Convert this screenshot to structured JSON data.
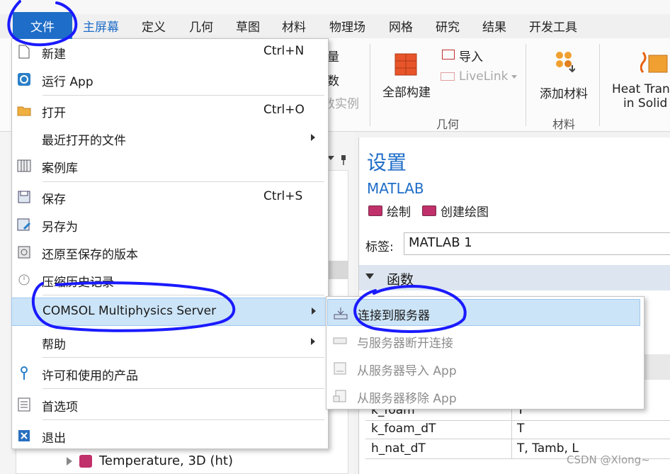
{
  "ribbon": {
    "tabs": [
      "文件",
      "主屏幕",
      "定义",
      "几何",
      "草图",
      "材料",
      "物理场",
      "网格",
      "研究",
      "结果",
      "开发工具"
    ],
    "partial_1": "量",
    "partial_2": "数",
    "partial_3": "数实例",
    "build_all": "全部构建",
    "import": "导入",
    "livelink": "LiveLink",
    "geometry_group": "几何",
    "add_material": "添加材料",
    "materials_group": "材料",
    "heat_line1": "Heat Tran",
    "heat_line2": "in Solid"
  },
  "file_menu": {
    "items": [
      {
        "icon": "new-file-icon",
        "label": "新建",
        "shortcut": "Ctrl+N"
      },
      {
        "icon": "run-app-icon",
        "label": "运行 App",
        "shortcut": ""
      },
      {
        "icon": "folder-icon",
        "label": "打开",
        "shortcut": "Ctrl+O"
      },
      {
        "icon": "",
        "label": "最近打开的文件",
        "shortcut": ""
      },
      {
        "icon": "library-icon",
        "label": "案例库",
        "shortcut": ""
      },
      {
        "icon": "save-icon",
        "label": "保存",
        "shortcut": "Ctrl+S"
      },
      {
        "icon": "save-as-icon",
        "label": "另存为",
        "shortcut": ""
      },
      {
        "icon": "revert-icon",
        "label": "还原至保存的版本",
        "shortcut": ""
      },
      {
        "icon": "compact-history-icon",
        "label": "压缩历史记录",
        "shortcut": ""
      },
      {
        "icon": "",
        "label": "COMSOL Multiphysics Server",
        "shortcut": ""
      },
      {
        "icon": "",
        "label": "帮助",
        "shortcut": ""
      },
      {
        "icon": "license-icon",
        "label": "许可和使用的产品",
        "shortcut": ""
      },
      {
        "icon": "preferences-icon",
        "label": "首选项",
        "shortcut": ""
      },
      {
        "icon": "exit-icon",
        "label": "退出",
        "shortcut": ""
      }
    ]
  },
  "server_submenu": {
    "items": [
      {
        "label": "连接到服务器",
        "enabled": true
      },
      {
        "label": "与服务器断开连接",
        "enabled": false
      },
      {
        "label": "从服务器导入 App",
        "enabled": false
      },
      {
        "label": "从服务器移除 App",
        "enabled": false
      }
    ]
  },
  "settings": {
    "title": "设置",
    "subtitle": "MATLAB",
    "plot_button": "绘制",
    "create_plot_button": "创建绘图",
    "label_caption": "标签:",
    "label_value": "MATLAB 1",
    "section": "函数",
    "rows": [
      {
        "name": "k_foam",
        "args": "T"
      },
      {
        "name": "k_foam_dT",
        "args": "T"
      },
      {
        "name": "h_nat_dT",
        "args": "T, Tamb, L"
      }
    ]
  },
  "tree": {
    "bottom_item": "Temperature, 3D (ht)"
  },
  "watermark": "CSDN @Xlong~",
  "colors": {
    "accent": "#1e6dc8",
    "highlight": "#cce4f7",
    "annotation": "#1a1aff"
  }
}
